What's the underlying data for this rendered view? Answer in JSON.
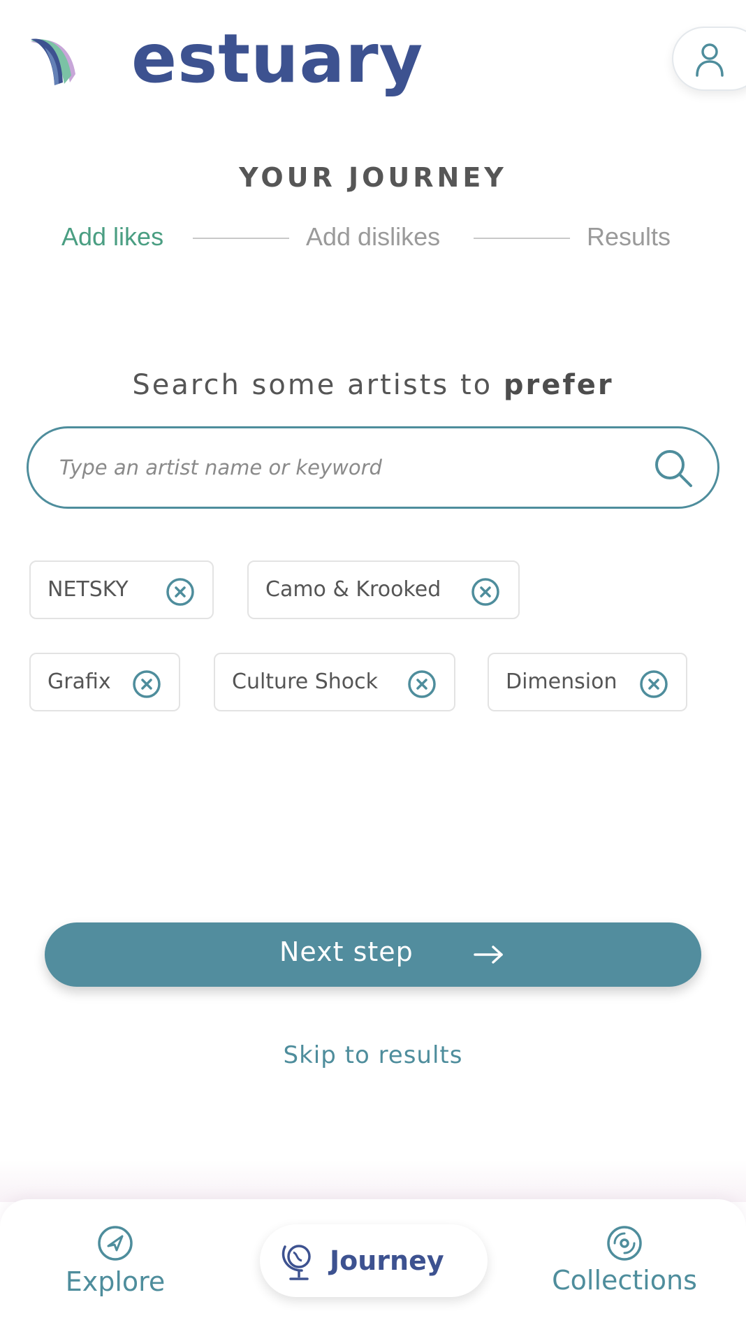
{
  "header": {
    "brand": "estuary"
  },
  "journey": {
    "title": "YOUR JOURNEY",
    "steps": [
      {
        "label": "Add likes",
        "active": true
      },
      {
        "label": "Add dislikes",
        "active": false
      },
      {
        "label": "Results",
        "active": false
      }
    ]
  },
  "search": {
    "heading_prefix": "Search some artists to ",
    "heading_emphasis": "prefer",
    "placeholder": "Type an artist name or keyword"
  },
  "chips": [
    {
      "label": "NETSKY"
    },
    {
      "label": "Camo & Krooked"
    },
    {
      "label": "Grafix"
    },
    {
      "label": "Culture Shock"
    },
    {
      "label": "Dimension"
    }
  ],
  "actions": {
    "next_label": "Next step",
    "skip_label": "Skip to results"
  },
  "nav": {
    "explore": "Explore",
    "journey": "Journey",
    "collections": "Collections",
    "active": "journey"
  },
  "colors": {
    "brand": "#3d5290",
    "teal": "#528d9e",
    "active_step": "#4a9e82",
    "inactive_step": "#9a9a9a"
  },
  "icons": [
    "estuary-logo-icon",
    "user-icon",
    "search-icon",
    "close-circle-icon",
    "arrow-right-icon",
    "compass-icon",
    "globe-icon",
    "disc-icon"
  ]
}
